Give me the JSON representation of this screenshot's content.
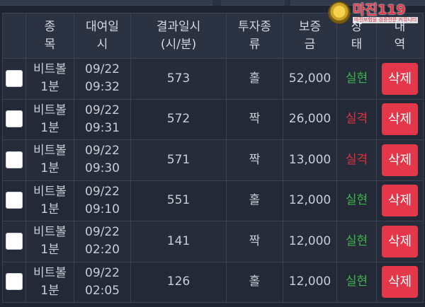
{
  "headers": {
    "select": "",
    "game": "종\n목",
    "bet_time": "대여일\n시",
    "result_time": "결과일시\n(시/분)",
    "bet_type": "투자종\n류",
    "amount": "보증\n금",
    "status": "상\n태",
    "history": "내\n역"
  },
  "rows": [
    {
      "game": "비트볼\n1분",
      "time": "09/22\n09:32",
      "round": "573",
      "pick": "홀",
      "amount": "52,000",
      "status": "실현",
      "status_kind": "win",
      "delete": "삭제"
    },
    {
      "game": "비트볼\n1분",
      "time": "09/22\n09:31",
      "round": "572",
      "pick": "짝",
      "amount": "26,000",
      "status": "실격",
      "status_kind": "lose",
      "delete": "삭제"
    },
    {
      "game": "비트볼\n1분",
      "time": "09/22\n09:30",
      "round": "571",
      "pick": "짝",
      "amount": "13,000",
      "status": "실격",
      "status_kind": "lose",
      "delete": "삭제"
    },
    {
      "game": "비트볼\n1분",
      "time": "09/22\n09:10",
      "round": "551",
      "pick": "홀",
      "amount": "12,000",
      "status": "실현",
      "status_kind": "win",
      "delete": "삭제"
    },
    {
      "game": "비트볼\n1분",
      "time": "09/22\n02:20",
      "round": "141",
      "pick": "짝",
      "amount": "12,000",
      "status": "실현",
      "status_kind": "win",
      "delete": "삭제"
    },
    {
      "game": "비트볼\n1분",
      "time": "09/22\n02:05",
      "round": "126",
      "pick": "홀",
      "amount": "12,000",
      "status": "실현",
      "status_kind": "win",
      "delete": "삭제"
    }
  ],
  "watermark": {
    "title": "마진119",
    "subtitle": "마진보험을 검증전문 커뮤니티"
  },
  "colors": {
    "win": "#3bb54a",
    "lose": "#e0313b",
    "delete_button": "#e4384a",
    "background": "#1f2533"
  }
}
